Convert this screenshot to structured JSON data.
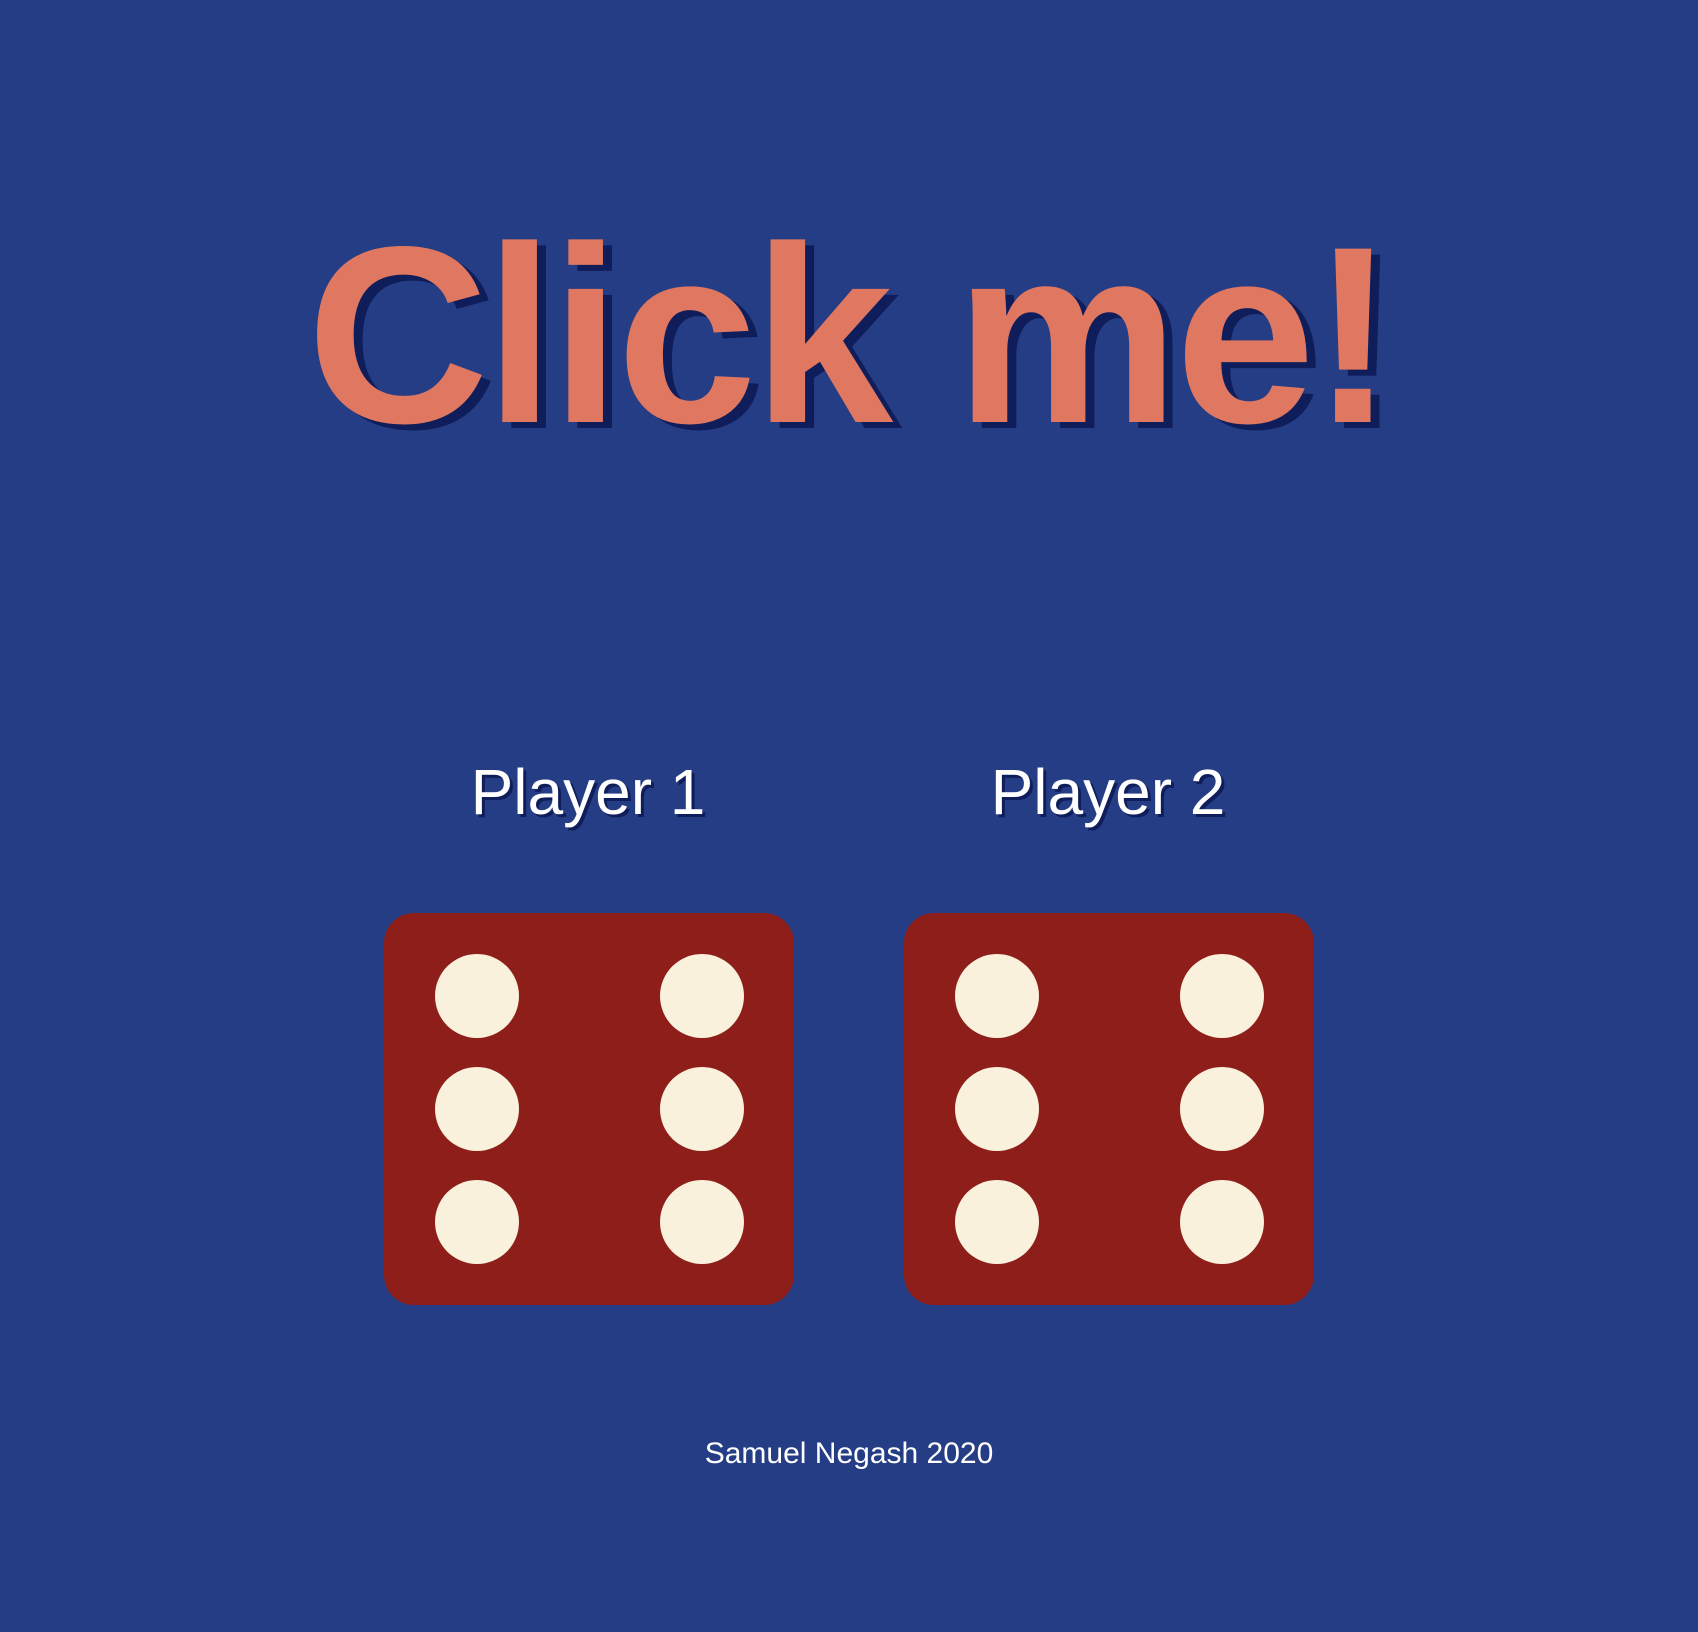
{
  "header": {
    "title": "Click me!"
  },
  "players": [
    {
      "label": "Player 1",
      "die_value": 6
    },
    {
      "label": "Player 2",
      "die_value": 6
    }
  ],
  "footer": {
    "text": "Samuel Negash 2020"
  },
  "colors": {
    "background": "#253d84",
    "title": "#e07760",
    "title_shadow": "#0f1d5a",
    "die_face": "#8e1e1a",
    "die_pip": "#f9f1dc",
    "text": "#ffffff"
  }
}
